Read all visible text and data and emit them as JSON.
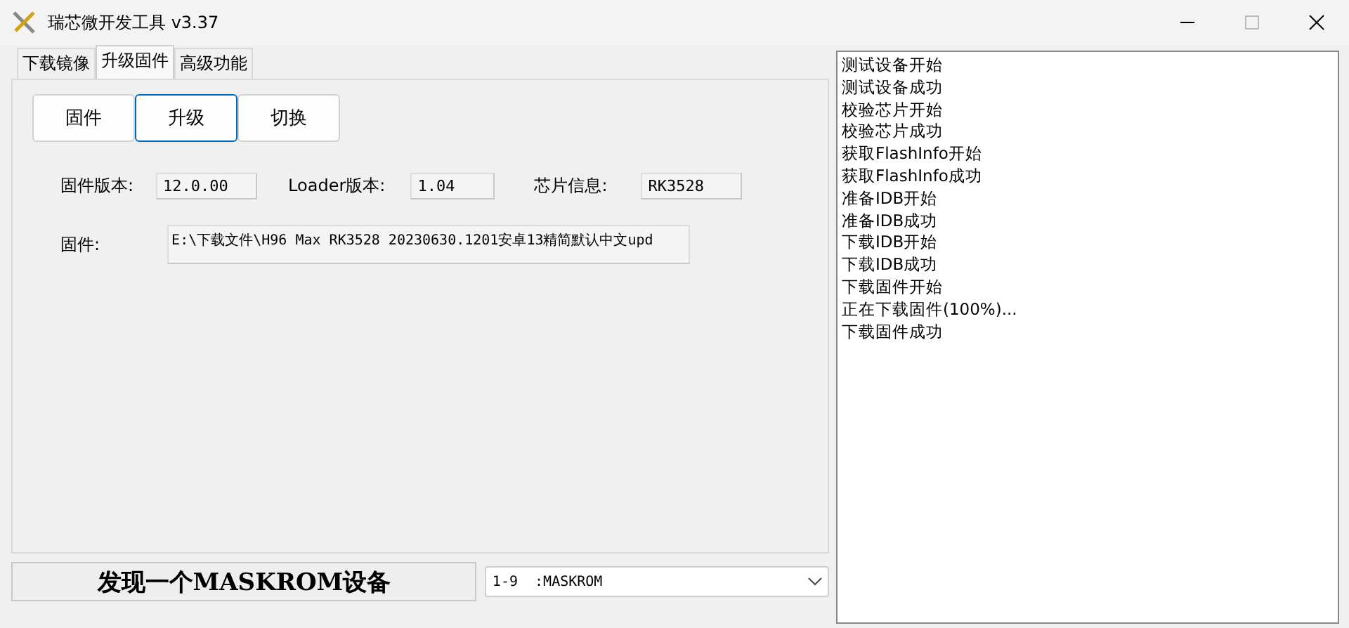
{
  "window": {
    "title": "瑞芯微开发工具 v3.37"
  },
  "tabs": [
    {
      "label": "下载镜像",
      "selected": false
    },
    {
      "label": "升级固件",
      "selected": true
    },
    {
      "label": "高级功能",
      "selected": false
    }
  ],
  "buttons": [
    {
      "label": "固件",
      "selected": false
    },
    {
      "label": "升级",
      "selected": true
    },
    {
      "label": "切换",
      "selected": false
    }
  ],
  "info": [
    {
      "label": "固件版本:",
      "value": "12.0.00"
    },
    {
      "label": "Loader版本:",
      "value": "1.04"
    },
    {
      "label": "芯片信息:",
      "value": "RK3528"
    }
  ],
  "firmware": {
    "label": "固件:",
    "value": "E:\\下载文件\\H96 Max RK3528 20230630.1201安卓13精简默认中文upd"
  },
  "status": "发现一个MASKROM设备",
  "device_select": {
    "value": "1-9  :MASKROM"
  },
  "log": [
    "测试设备开始",
    "测试设备成功",
    "校验芯片开始",
    "校验芯片成功",
    "获取FlashInfo开始",
    "获取FlashInfo成功",
    "准备IDB开始",
    "准备IDB成功",
    "下载IDB开始",
    "下载IDB成功",
    "下载固件开始",
    "正在下载固件(100%)...",
    "下载固件成功"
  ]
}
